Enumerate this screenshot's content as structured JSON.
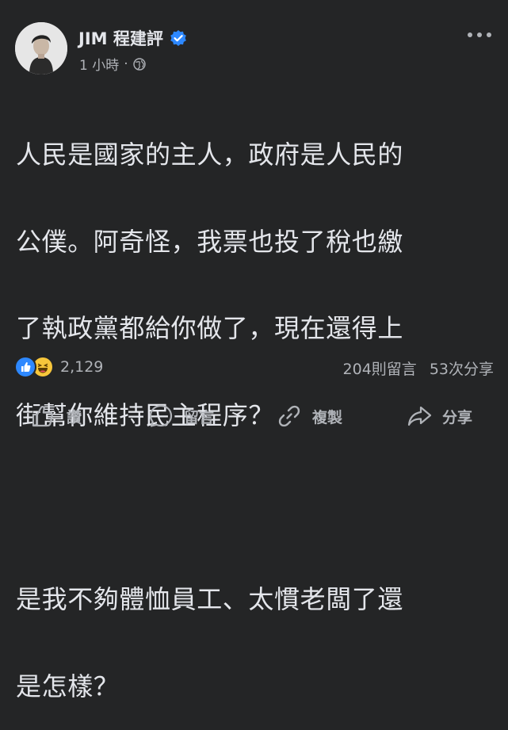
{
  "post": {
    "author": "JIM 程建評",
    "time": "1 小時",
    "separator": "·",
    "text_lines": [
      "人民是國家的主人，政府是人民的",
      "公僕。阿奇怪，我票也投了稅也繳",
      "了執政黨都給你做了，現在還得上",
      "街幫你維持民主程序？"
    ],
    "text_lines_2": [
      "是我不夠體恤員工、太慣老闆了還",
      "是怎樣？"
    ]
  },
  "stats": {
    "reaction_count": "2,129",
    "comments": "204則留言",
    "shares": "53次分享"
  },
  "actions": {
    "like": "讚",
    "comment": "留言",
    "copy": "複製",
    "share": "分享"
  },
  "colors": {
    "background": "#242526",
    "text_primary": "#e4e6eb",
    "text_secondary": "#b0b3b8",
    "verified_blue": "#2d88ff",
    "haha_yellow": "#f7c63b"
  },
  "icons": {
    "verified": "verified-badge-icon",
    "audience": "globe-icon",
    "more": "more-options-icon",
    "like": "thumbs-up-icon",
    "comment": "comment-bubble-icon",
    "copy": "link-icon",
    "share": "share-arrow-icon"
  }
}
